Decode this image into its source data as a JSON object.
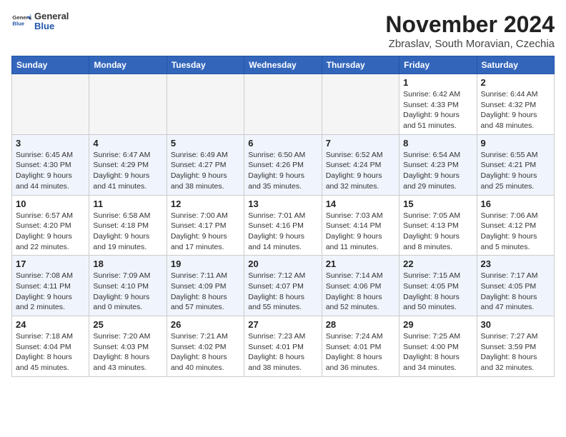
{
  "header": {
    "logo_general": "General",
    "logo_blue": "Blue",
    "month_title": "November 2024",
    "location": "Zbraslav, South Moravian, Czechia"
  },
  "weekdays": [
    "Sunday",
    "Monday",
    "Tuesday",
    "Wednesday",
    "Thursday",
    "Friday",
    "Saturday"
  ],
  "weeks": [
    [
      {
        "day": "",
        "empty": true
      },
      {
        "day": "",
        "empty": true
      },
      {
        "day": "",
        "empty": true
      },
      {
        "day": "",
        "empty": true
      },
      {
        "day": "",
        "empty": true
      },
      {
        "day": "1",
        "sunrise": "6:42 AM",
        "sunset": "4:33 PM",
        "daylight": "9 hours and 51 minutes."
      },
      {
        "day": "2",
        "sunrise": "6:44 AM",
        "sunset": "4:32 PM",
        "daylight": "9 hours and 48 minutes."
      }
    ],
    [
      {
        "day": "3",
        "sunrise": "6:45 AM",
        "sunset": "4:30 PM",
        "daylight": "9 hours and 44 minutes."
      },
      {
        "day": "4",
        "sunrise": "6:47 AM",
        "sunset": "4:29 PM",
        "daylight": "9 hours and 41 minutes."
      },
      {
        "day": "5",
        "sunrise": "6:49 AM",
        "sunset": "4:27 PM",
        "daylight": "9 hours and 38 minutes."
      },
      {
        "day": "6",
        "sunrise": "6:50 AM",
        "sunset": "4:26 PM",
        "daylight": "9 hours and 35 minutes."
      },
      {
        "day": "7",
        "sunrise": "6:52 AM",
        "sunset": "4:24 PM",
        "daylight": "9 hours and 32 minutes."
      },
      {
        "day": "8",
        "sunrise": "6:54 AM",
        "sunset": "4:23 PM",
        "daylight": "9 hours and 29 minutes."
      },
      {
        "day": "9",
        "sunrise": "6:55 AM",
        "sunset": "4:21 PM",
        "daylight": "9 hours and 25 minutes."
      }
    ],
    [
      {
        "day": "10",
        "sunrise": "6:57 AM",
        "sunset": "4:20 PM",
        "daylight": "9 hours and 22 minutes."
      },
      {
        "day": "11",
        "sunrise": "6:58 AM",
        "sunset": "4:18 PM",
        "daylight": "9 hours and 19 minutes."
      },
      {
        "day": "12",
        "sunrise": "7:00 AM",
        "sunset": "4:17 PM",
        "daylight": "9 hours and 17 minutes."
      },
      {
        "day": "13",
        "sunrise": "7:01 AM",
        "sunset": "4:16 PM",
        "daylight": "9 hours and 14 minutes."
      },
      {
        "day": "14",
        "sunrise": "7:03 AM",
        "sunset": "4:14 PM",
        "daylight": "9 hours and 11 minutes."
      },
      {
        "day": "15",
        "sunrise": "7:05 AM",
        "sunset": "4:13 PM",
        "daylight": "9 hours and 8 minutes."
      },
      {
        "day": "16",
        "sunrise": "7:06 AM",
        "sunset": "4:12 PM",
        "daylight": "9 hours and 5 minutes."
      }
    ],
    [
      {
        "day": "17",
        "sunrise": "7:08 AM",
        "sunset": "4:11 PM",
        "daylight": "9 hours and 2 minutes."
      },
      {
        "day": "18",
        "sunrise": "7:09 AM",
        "sunset": "4:10 PM",
        "daylight": "9 hours and 0 minutes."
      },
      {
        "day": "19",
        "sunrise": "7:11 AM",
        "sunset": "4:09 PM",
        "daylight": "8 hours and 57 minutes."
      },
      {
        "day": "20",
        "sunrise": "7:12 AM",
        "sunset": "4:07 PM",
        "daylight": "8 hours and 55 minutes."
      },
      {
        "day": "21",
        "sunrise": "7:14 AM",
        "sunset": "4:06 PM",
        "daylight": "8 hours and 52 minutes."
      },
      {
        "day": "22",
        "sunrise": "7:15 AM",
        "sunset": "4:05 PM",
        "daylight": "8 hours and 50 minutes."
      },
      {
        "day": "23",
        "sunrise": "7:17 AM",
        "sunset": "4:05 PM",
        "daylight": "8 hours and 47 minutes."
      }
    ],
    [
      {
        "day": "24",
        "sunrise": "7:18 AM",
        "sunset": "4:04 PM",
        "daylight": "8 hours and 45 minutes."
      },
      {
        "day": "25",
        "sunrise": "7:20 AM",
        "sunset": "4:03 PM",
        "daylight": "8 hours and 43 minutes."
      },
      {
        "day": "26",
        "sunrise": "7:21 AM",
        "sunset": "4:02 PM",
        "daylight": "8 hours and 40 minutes."
      },
      {
        "day": "27",
        "sunrise": "7:23 AM",
        "sunset": "4:01 PM",
        "daylight": "8 hours and 38 minutes."
      },
      {
        "day": "28",
        "sunrise": "7:24 AM",
        "sunset": "4:01 PM",
        "daylight": "8 hours and 36 minutes."
      },
      {
        "day": "29",
        "sunrise": "7:25 AM",
        "sunset": "4:00 PM",
        "daylight": "8 hours and 34 minutes."
      },
      {
        "day": "30",
        "sunrise": "7:27 AM",
        "sunset": "3:59 PM",
        "daylight": "8 hours and 32 minutes."
      }
    ]
  ],
  "labels": {
    "sunrise": "Sunrise:",
    "sunset": "Sunset:",
    "daylight": "Daylight:"
  }
}
